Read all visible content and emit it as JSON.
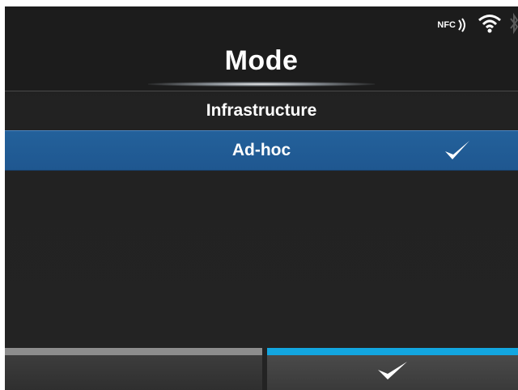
{
  "header": {
    "title": "Mode",
    "status": {
      "nfc_label": "NFC",
      "wifi_icon": "wifi-icon",
      "bluetooth_icon": "bluetooth-icon"
    }
  },
  "list": {
    "items": [
      {
        "label": "Infrastructure",
        "selected": false
      },
      {
        "label": "Ad-hoc",
        "selected": true
      }
    ],
    "check_icon": "checkmark-icon"
  },
  "footer": {
    "left_button_icon": "",
    "right_button_icon": "checkmark-icon"
  },
  "colors": {
    "selected_row": "#1f5790",
    "accent_bar": "#12a6e0",
    "inactive_bar": "#8d8d8d"
  }
}
